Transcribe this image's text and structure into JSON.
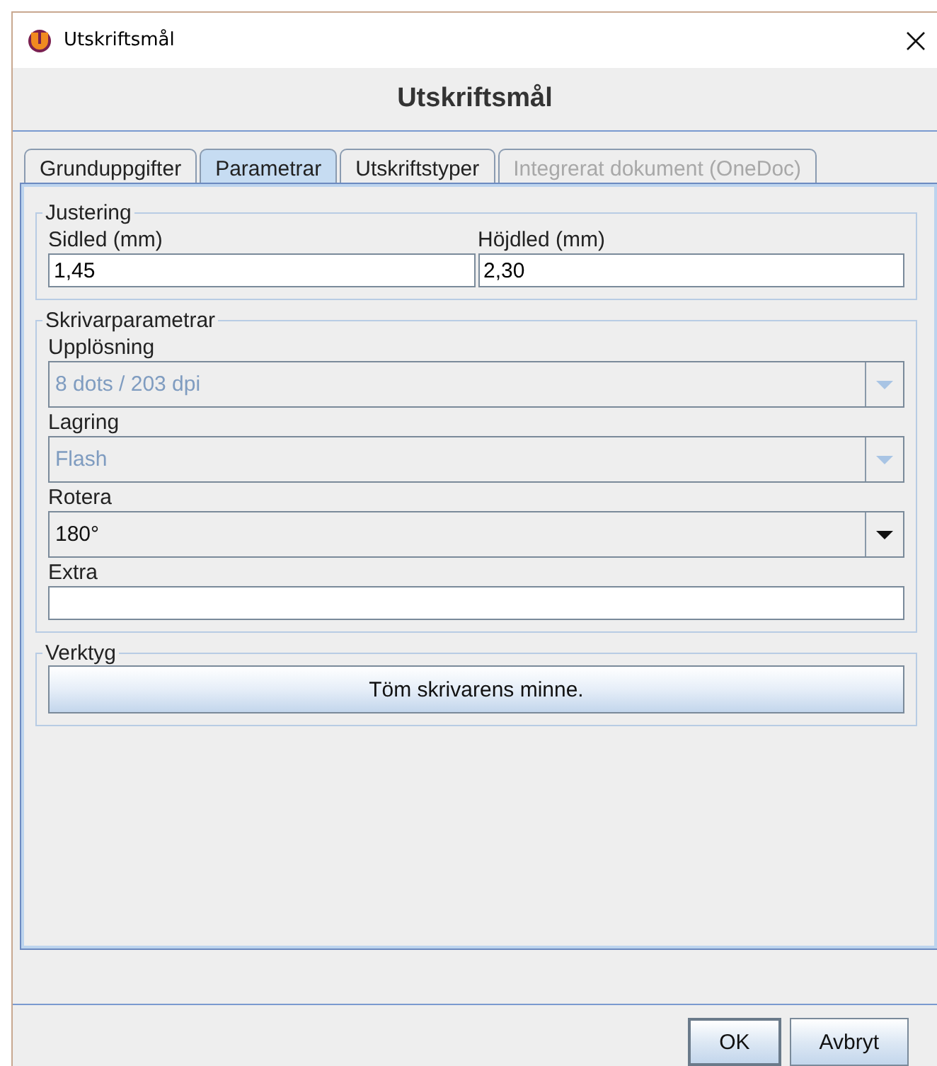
{
  "window": {
    "title": "Utskriftsmål"
  },
  "header": "Utskriftsmål",
  "tabs": [
    {
      "label": "Grunduppgifter",
      "selected": false,
      "disabled": false
    },
    {
      "label": "Parametrar",
      "selected": true,
      "disabled": false
    },
    {
      "label": "Utskriftstyper",
      "selected": false,
      "disabled": false
    },
    {
      "label": "Integrerat dokument (OneDoc)",
      "selected": false,
      "disabled": true
    }
  ],
  "justering": {
    "legend": "Justering",
    "fields": [
      {
        "label": "Sidled (mm)",
        "value": "1,45"
      },
      {
        "label": "Höjdled (mm)",
        "value": "2,30"
      }
    ]
  },
  "skrivarparametrar": {
    "legend": "Skrivarparametrar",
    "rows": [
      {
        "kind": "dropdown",
        "label": "Upplösning",
        "value": "8 dots / 203 dpi",
        "disabled": true
      },
      {
        "kind": "dropdown",
        "label": "Lagring",
        "value": "Flash",
        "disabled": true
      },
      {
        "kind": "dropdown",
        "label": "Rotera",
        "value": "180°",
        "disabled": false
      },
      {
        "kind": "text",
        "label": "Extra",
        "value": ""
      }
    ]
  },
  "verktyg": {
    "legend": "Verktyg",
    "button": "Töm skrivarens minne."
  },
  "buttons": [
    "OK",
    "Avbryt"
  ]
}
